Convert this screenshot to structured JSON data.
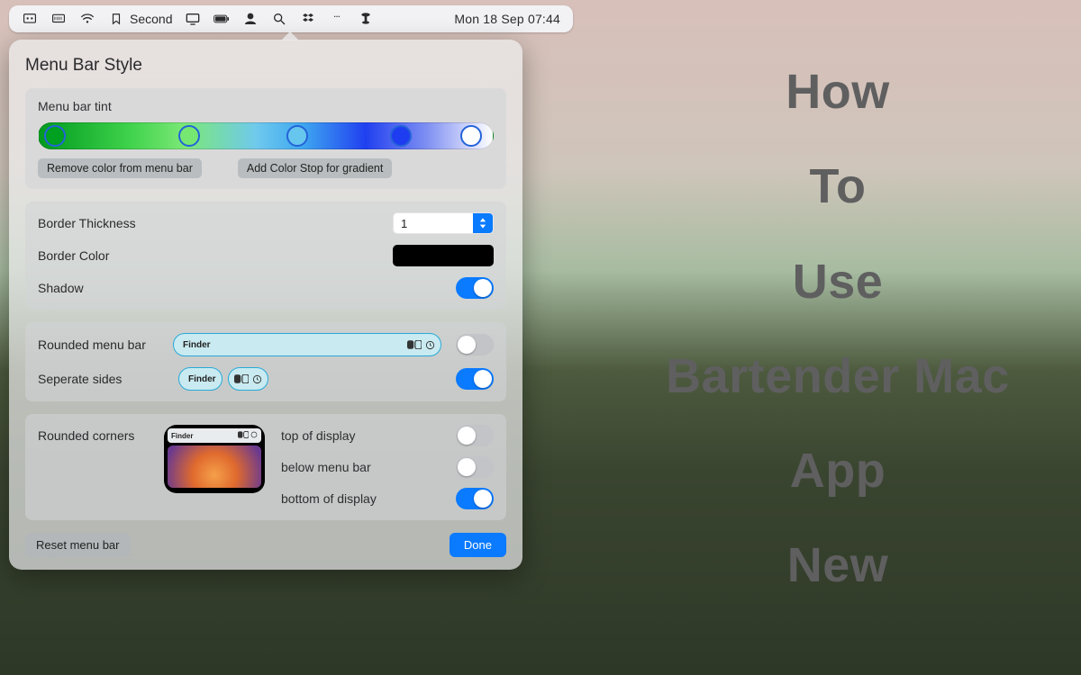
{
  "menubar": {
    "bookmark_label": "Second",
    "datetime": "Mon 18 Sep  07:44"
  },
  "overlay": {
    "line1": "How",
    "line2": "To",
    "line3": "Use",
    "line4": "Bartender Mac",
    "line5": "App",
    "line6": "New"
  },
  "window": {
    "title": "Menu Bar Style",
    "tint": {
      "label": "Menu bar tint",
      "remove_btn": "Remove color from menu bar",
      "add_btn": "Add Color Stop for gradient",
      "stops": [
        "#00a020",
        "#76e872",
        "#67c6ee",
        "#1f3df0",
        "#ffffff"
      ]
    },
    "border": {
      "thickness_label": "Border Thickness",
      "thickness_value": "1",
      "color_label": "Border Color",
      "color_value": "#000000",
      "shadow_label": "Shadow",
      "shadow_on": true
    },
    "shape": {
      "rounded_label": "Rounded menu bar",
      "rounded_on": false,
      "separate_label": "Seperate sides",
      "separate_on": true,
      "preview_finder": "Finder"
    },
    "corners": {
      "label": "Rounded corners",
      "top_label": "top of display",
      "top_on": false,
      "below_label": "below menu bar",
      "below_on": false,
      "bottom_label": "bottom of display",
      "bottom_on": true,
      "preview_finder": "Finder"
    },
    "footer": {
      "reset": "Reset menu bar",
      "done": "Done"
    }
  }
}
